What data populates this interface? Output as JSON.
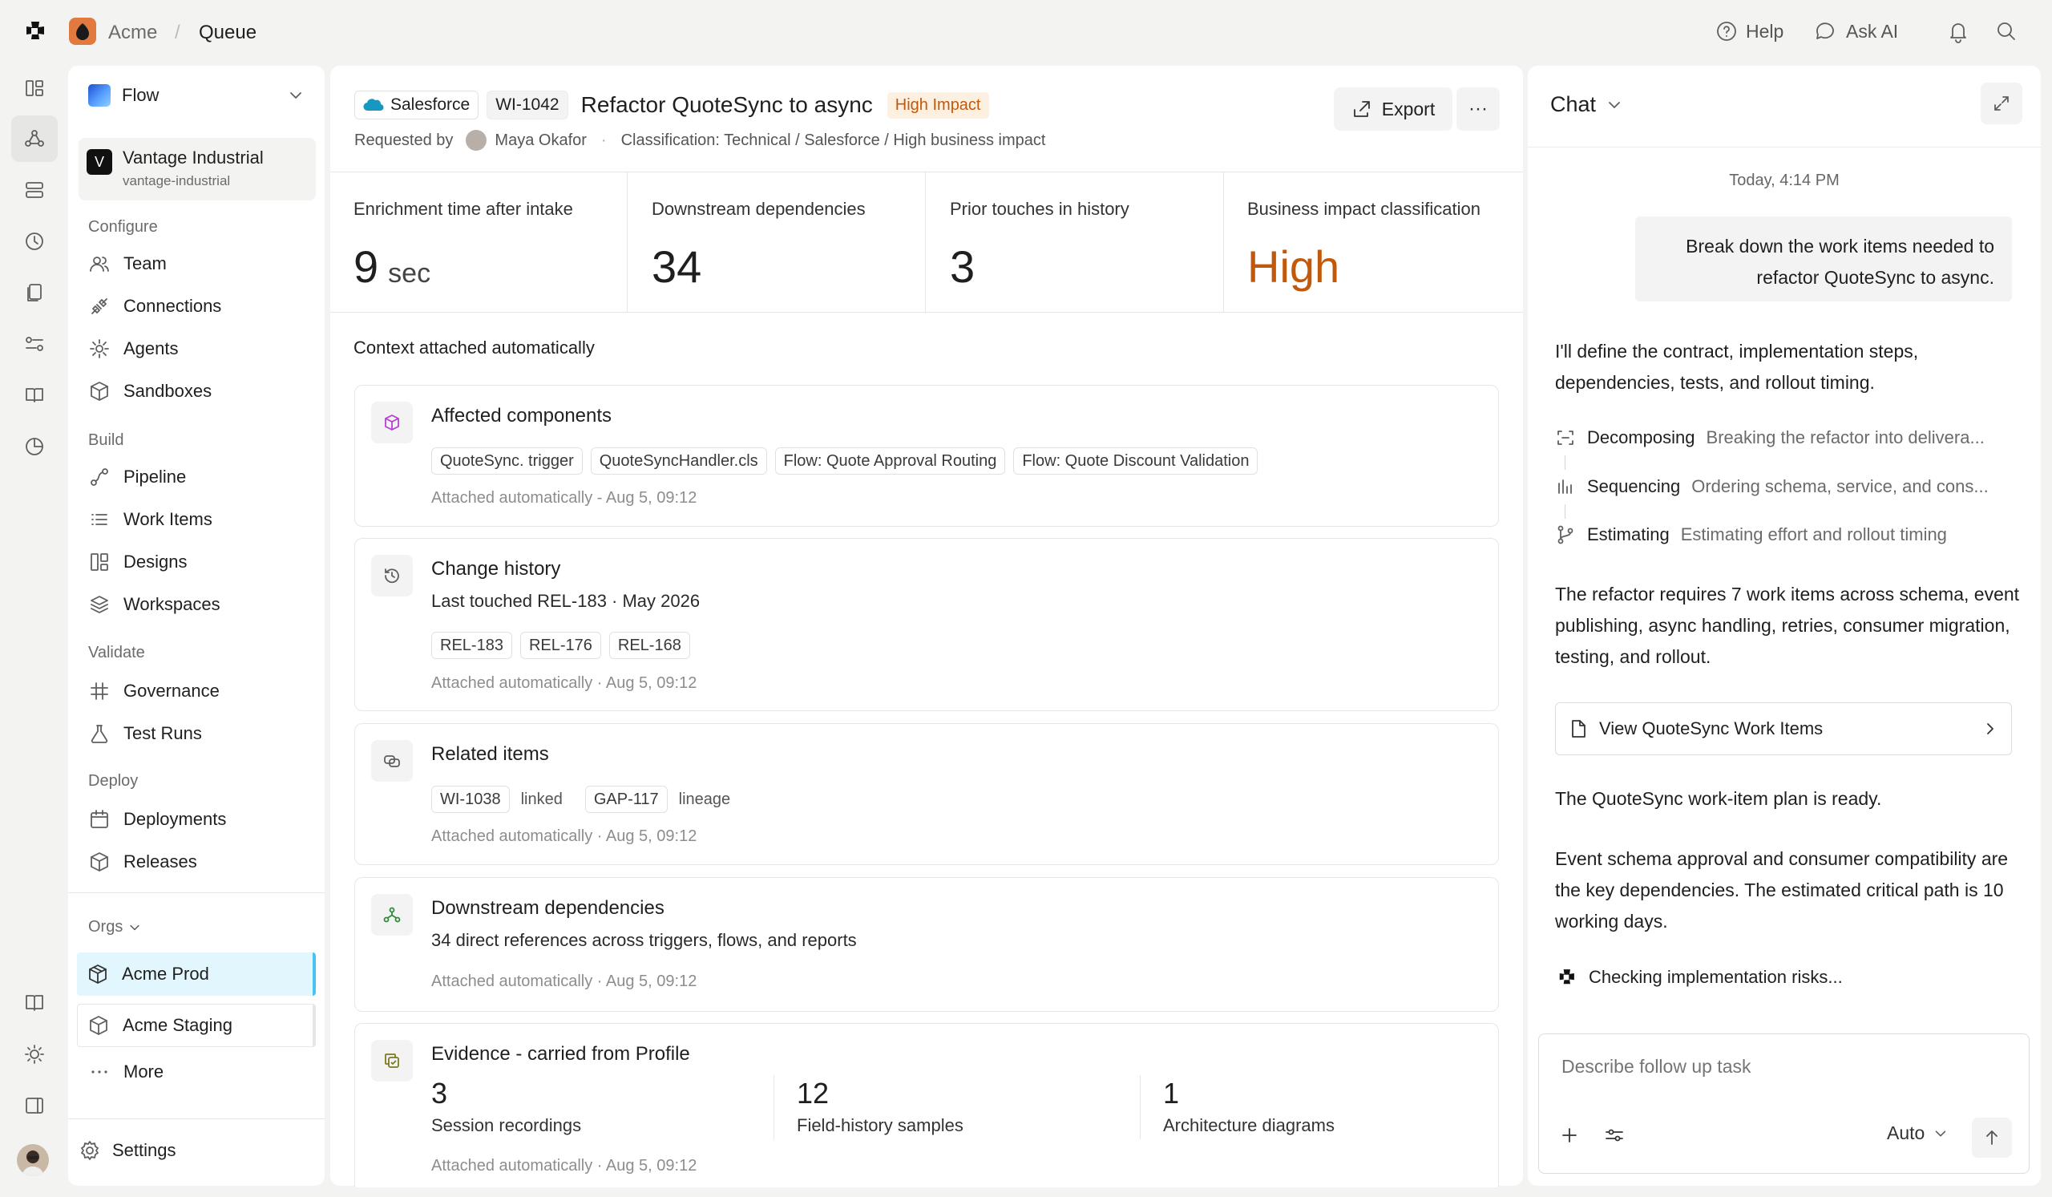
{
  "app": {
    "breadcrumb": [
      "Acme",
      "Queue"
    ],
    "help_label": "Help",
    "ask_ai_label": "Ask AI"
  },
  "sidebar": {
    "flow_label": "Flow",
    "workspace": {
      "name": "Vantage Industrial",
      "slug": "vantage-industrial",
      "initial": "V"
    },
    "sections": [
      {
        "title": "Configure",
        "items": [
          "Team",
          "Connections",
          "Agents",
          "Sandboxes"
        ]
      },
      {
        "title": "Build",
        "items": [
          "Pipeline",
          "Work Items",
          "Designs",
          "Workspaces"
        ]
      },
      {
        "title": "Validate",
        "items": [
          "Governance",
          "Test Runs"
        ]
      },
      {
        "title": "Deploy",
        "items": [
          "Deployments",
          "Releases"
        ]
      }
    ],
    "orgs_label": "Orgs",
    "orgs": [
      "Acme Prod",
      "Acme Staging"
    ],
    "more_label": "More",
    "settings_label": "Settings"
  },
  "header": {
    "source": "Salesforce",
    "id": "WI-1042",
    "title": "Refactor QuoteSync to async",
    "badge": "High Impact",
    "requested_by_label": "Requested by",
    "requester": "Maya Okafor",
    "classification": "Classification: Technical / Salesforce / High business impact",
    "export_label": "Export",
    "more_label": "···"
  },
  "metrics": [
    {
      "label": "Enrichment time after intake",
      "value": "9",
      "unit": "sec"
    },
    {
      "label": "Downstream dependencies",
      "value": "34",
      "unit": ""
    },
    {
      "label": "Prior touches in history",
      "value": "3",
      "unit": ""
    },
    {
      "label": "Business impact classification",
      "value": "High",
      "unit": ""
    }
  ],
  "context_title": "Context attached automatically",
  "cards": {
    "affected": {
      "title": "Affected components",
      "chips": [
        "QuoteSync. trigger",
        "QuoteSyncHandler.cls",
        "Flow: Quote Approval Routing",
        "Flow: Quote Discount Validation"
      ],
      "meta": "Attached automatically - Aug 5, 09:12"
    },
    "history": {
      "title": "Change history",
      "sub": "Last touched REL-183 · May 2026",
      "chips": [
        "REL-183",
        "REL-176",
        "REL-168"
      ],
      "meta": "Attached automatically · Aug 5, 09:12"
    },
    "related": {
      "title": "Related items",
      "chip1": "WI-1038",
      "rel1": "linked",
      "chip2": "GAP-117",
      "rel2": "lineage",
      "meta": "Attached automatically · Aug 5, 09:12"
    },
    "downstream": {
      "title": "Downstream dependencies",
      "sub": "34 direct references across triggers, flows, and reports",
      "meta": "Attached automatically · Aug 5, 09:12"
    },
    "evidence": {
      "title": "Evidence - carried from Profile",
      "stats": [
        {
          "value": "3",
          "label": "Session recordings"
        },
        {
          "value": "12",
          "label": "Field-history samples"
        },
        {
          "value": "1",
          "label": "Architecture diagrams"
        }
      ],
      "meta": "Attached automatically · Aug 5, 09:12"
    }
  },
  "chat": {
    "title": "Chat",
    "timestamp": "Today, 4:14 PM",
    "user_message": "Break down the work items needed to refactor QuoteSync to async.",
    "reply1": "I'll define the contract, implementation steps, dependencies, tests, and rollout timing.",
    "steps": [
      {
        "title": "Decomposing",
        "desc": "Breaking the refactor into delivera..."
      },
      {
        "title": "Sequencing",
        "desc": "Ordering schema, service, and cons..."
      },
      {
        "title": "Estimating",
        "desc": "Estimating effort and rollout timing"
      }
    ],
    "reply2": "The refactor requires 7 work items across schema, event publishing, async handling, retries, consumer migration, testing, and rollout.",
    "link_label": "View QuoteSync Work Items",
    "reply3": "The QuoteSync work-item plan is ready.",
    "reply4": "Event schema approval and consumer compatibility are the key dependencies. The estimated critical path is 10 working days.",
    "status": "Checking implementation risks...",
    "input_placeholder": "Describe follow up task",
    "mode_label": "Auto"
  },
  "colors": {
    "accent_orange": "#c2590a",
    "badge_bg": "#fdf0e1",
    "org_active_bg": "#e2f6fd"
  }
}
